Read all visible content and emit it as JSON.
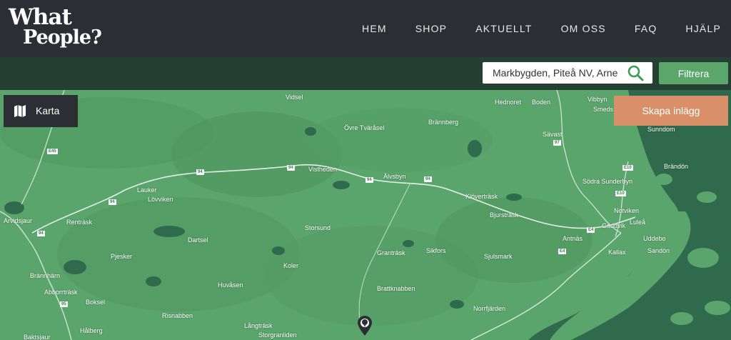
{
  "header": {
    "logo_line1": "What",
    "logo_line2": "People?",
    "nav": [
      {
        "label": "HEM"
      },
      {
        "label": "SHOP"
      },
      {
        "label": "AKTUELLT"
      },
      {
        "label": "OM OSS"
      },
      {
        "label": "FAQ"
      },
      {
        "label": "HJÄLP"
      }
    ]
  },
  "filter": {
    "search_value": "Markbygden, Piteå NV, Arne",
    "search_icon": "search-icon",
    "filter_label": "Filtrera"
  },
  "map": {
    "karta_label": "Karta",
    "karta_icon": "map-icon",
    "create_label": "Skapa inlägg",
    "pin_icon": "tree-pin-icon",
    "places": [
      "Vidsel",
      "Hednoret",
      "Boden",
      "Vibbyn",
      "Smeds",
      "Övre Tväråsel",
      "Brännberg",
      "Sunndom",
      "Sävast",
      "Brändön",
      "Lauker",
      "Lövviken",
      "Vistheden",
      "Älvsbyn",
      "Södra Sunderbyn",
      "Arvidsjaur",
      "Renträsk",
      "Klöverträsk",
      "Notviken",
      "Luleå",
      "Bjursträsk",
      "Gäddvik",
      "Uddebo",
      "Dartsel",
      "Storsund",
      "Antnäs",
      "Pjesker",
      "Granträsk",
      "Sikfors",
      "Sjulsmark",
      "Kallax",
      "Sandön",
      "Brännhärn",
      "Koler",
      "Abborrträsk",
      "Huvåsen",
      "Brattknabben",
      "Boksel",
      "Risnabben",
      "Norrfjärden",
      "Långträsk",
      "Hålberg",
      "Baktsjaur",
      "Storgranliden"
    ],
    "roads": [
      "E45",
      "94",
      "94",
      "94",
      "94",
      "94",
      "94",
      "E4",
      "E4",
      "E10",
      "E10",
      "97",
      "95"
    ]
  },
  "colors": {
    "header_bg": "#2b2e33",
    "filterbar_bg": "#263f33",
    "map_land": "#5aa56c",
    "map_water": "#2f6a4d",
    "accent_green": "#5aa66b",
    "create_orange": "#d99068"
  }
}
